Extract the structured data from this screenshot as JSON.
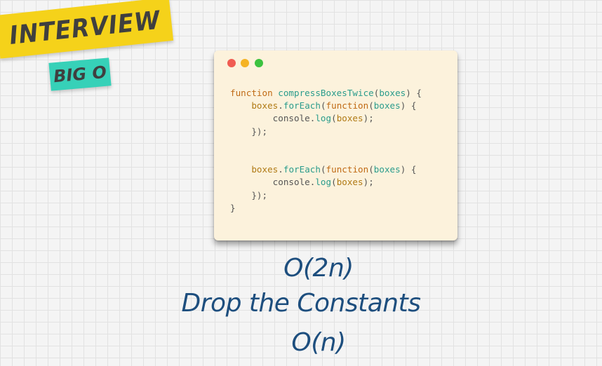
{
  "badge": {
    "title": "INTERVIEW",
    "subtitle": "BIG O",
    "title_color": "#f5d21a",
    "subtitle_color": "#36d1b8"
  },
  "code_window": {
    "background": "#fcf2dc",
    "controls": [
      "close-dot",
      "minimize-dot",
      "zoom-dot"
    ],
    "lines": [
      [
        {
          "t": "function ",
          "c": "kw"
        },
        {
          "t": "compressBoxesTwice",
          "c": "fn"
        },
        {
          "t": "(",
          "c": "punc"
        },
        {
          "t": "boxes",
          "c": "fn"
        },
        {
          "t": ") {",
          "c": "punc"
        }
      ],
      [
        {
          "t": "    ",
          "c": "punc"
        },
        {
          "t": "boxes",
          "c": "param"
        },
        {
          "t": ".",
          "c": "punc"
        },
        {
          "t": "forEach",
          "c": "id"
        },
        {
          "t": "(",
          "c": "punc"
        },
        {
          "t": "function",
          "c": "kw"
        },
        {
          "t": "(",
          "c": "punc"
        },
        {
          "t": "boxes",
          "c": "id"
        },
        {
          "t": ") {",
          "c": "punc"
        }
      ],
      [
        {
          "t": "        ",
          "c": "punc"
        },
        {
          "t": "console",
          "c": "punc"
        },
        {
          "t": ".",
          "c": "punc"
        },
        {
          "t": "log",
          "c": "id"
        },
        {
          "t": "(",
          "c": "punc"
        },
        {
          "t": "boxes",
          "c": "param"
        },
        {
          "t": ");",
          "c": "punc"
        }
      ],
      [
        {
          "t": "    });",
          "c": "punc"
        }
      ],
      [],
      [],
      [
        {
          "t": "    ",
          "c": "punc"
        },
        {
          "t": "boxes",
          "c": "param"
        },
        {
          "t": ".",
          "c": "punc"
        },
        {
          "t": "forEach",
          "c": "id"
        },
        {
          "t": "(",
          "c": "punc"
        },
        {
          "t": "function",
          "c": "kw"
        },
        {
          "t": "(",
          "c": "punc"
        },
        {
          "t": "boxes",
          "c": "id"
        },
        {
          "t": ") {",
          "c": "punc"
        }
      ],
      [
        {
          "t": "        ",
          "c": "punc"
        },
        {
          "t": "console",
          "c": "punc"
        },
        {
          "t": ".",
          "c": "punc"
        },
        {
          "t": "log",
          "c": "id"
        },
        {
          "t": "(",
          "c": "punc"
        },
        {
          "t": "boxes",
          "c": "param"
        },
        {
          "t": ");",
          "c": "punc"
        }
      ],
      [
        {
          "t": "    });",
          "c": "punc"
        }
      ],
      [
        {
          "t": "}",
          "c": "punc"
        }
      ]
    ]
  },
  "captions": {
    "complexity": "O(2n)",
    "rule": "Drop the Constants",
    "result": "O(n)",
    "color": "#1d4e7e"
  }
}
